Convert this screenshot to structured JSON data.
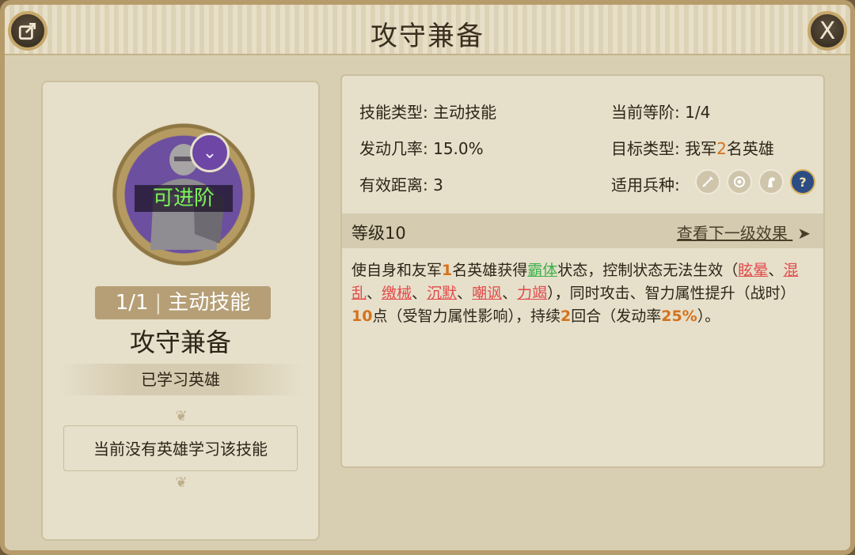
{
  "header": {
    "title": "攻守兼备",
    "share_icon": "share-icon",
    "close_glyph": "X"
  },
  "left": {
    "advance_tag": "可进阶",
    "level_count": "1/1",
    "skill_kind": "主动技能",
    "skill_name": "攻守兼备",
    "learned_label": "已学习英雄",
    "no_hero_text": "当前没有英雄学习该技能"
  },
  "info": {
    "type_label": "技能类型:",
    "type_value": "主动技能",
    "rank_label": "当前等阶:",
    "rank_value": "1/4",
    "rate_label": "发动几率:",
    "rate_value": "15.0%",
    "target_label": "目标类型:",
    "target_pre": "我军",
    "target_num": "2",
    "target_post": "名英雄",
    "range_label": "有效距离:",
    "range_value": "3",
    "troop_label": "适用兵种:",
    "troop_icons": [
      "sword-icon",
      "bow-icon",
      "horse-icon",
      "question-icon"
    ]
  },
  "level": {
    "label": "等级10",
    "next_link": "查看下一级效果",
    "arrow": "➤"
  },
  "description": {
    "p1": "使自身和友军",
    "n1": "1",
    "p2": "名英雄获得",
    "g1": "霸体",
    "p3": "状态，控制状态无法生效（",
    "r1": "眩晕",
    "s1": "、",
    "r2": "混乱",
    "s2": "、",
    "r3": "缴械",
    "s3": "、",
    "r4": "沉默",
    "s4": "、",
    "r5": "嘲讽",
    "s5": "、",
    "r6": "力竭",
    "p4": "），同时攻击、智力属性提升（战时）",
    "n2": "10",
    "p5": "点（受智力属性影响），持续",
    "n3": "2",
    "p6": "回合（发动率",
    "n4": "25%",
    "p7": "）。"
  },
  "colors": {
    "highlight_orange": "#d4721c",
    "status_green": "#3bb24a",
    "control_red": "#e24a4a",
    "advance_green": "#7cf25a",
    "panel_bg": "#e6dfca"
  }
}
